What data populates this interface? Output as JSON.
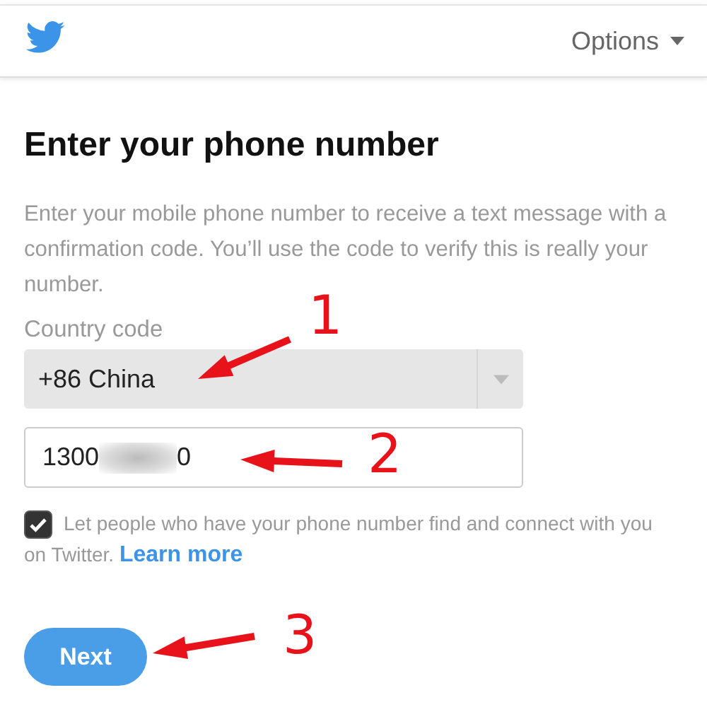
{
  "header": {
    "options_label": "Options"
  },
  "title": "Enter your phone number",
  "description": "Enter your mobile phone number to receive a text message with a confirmation code. You’ll use the code to verify this is really your number.",
  "country_field": {
    "label": "Country code",
    "value": "+86 China"
  },
  "phone_field": {
    "value_start": "1300",
    "value_end": "0"
  },
  "discoverable": {
    "checked": true,
    "text": "Let people who have your phone number find and connect with you on Twitter.",
    "link": "Learn more"
  },
  "next_button": "Next",
  "annotations": [
    {
      "label": "1"
    },
    {
      "label": "2"
    },
    {
      "label": "3"
    }
  ]
}
